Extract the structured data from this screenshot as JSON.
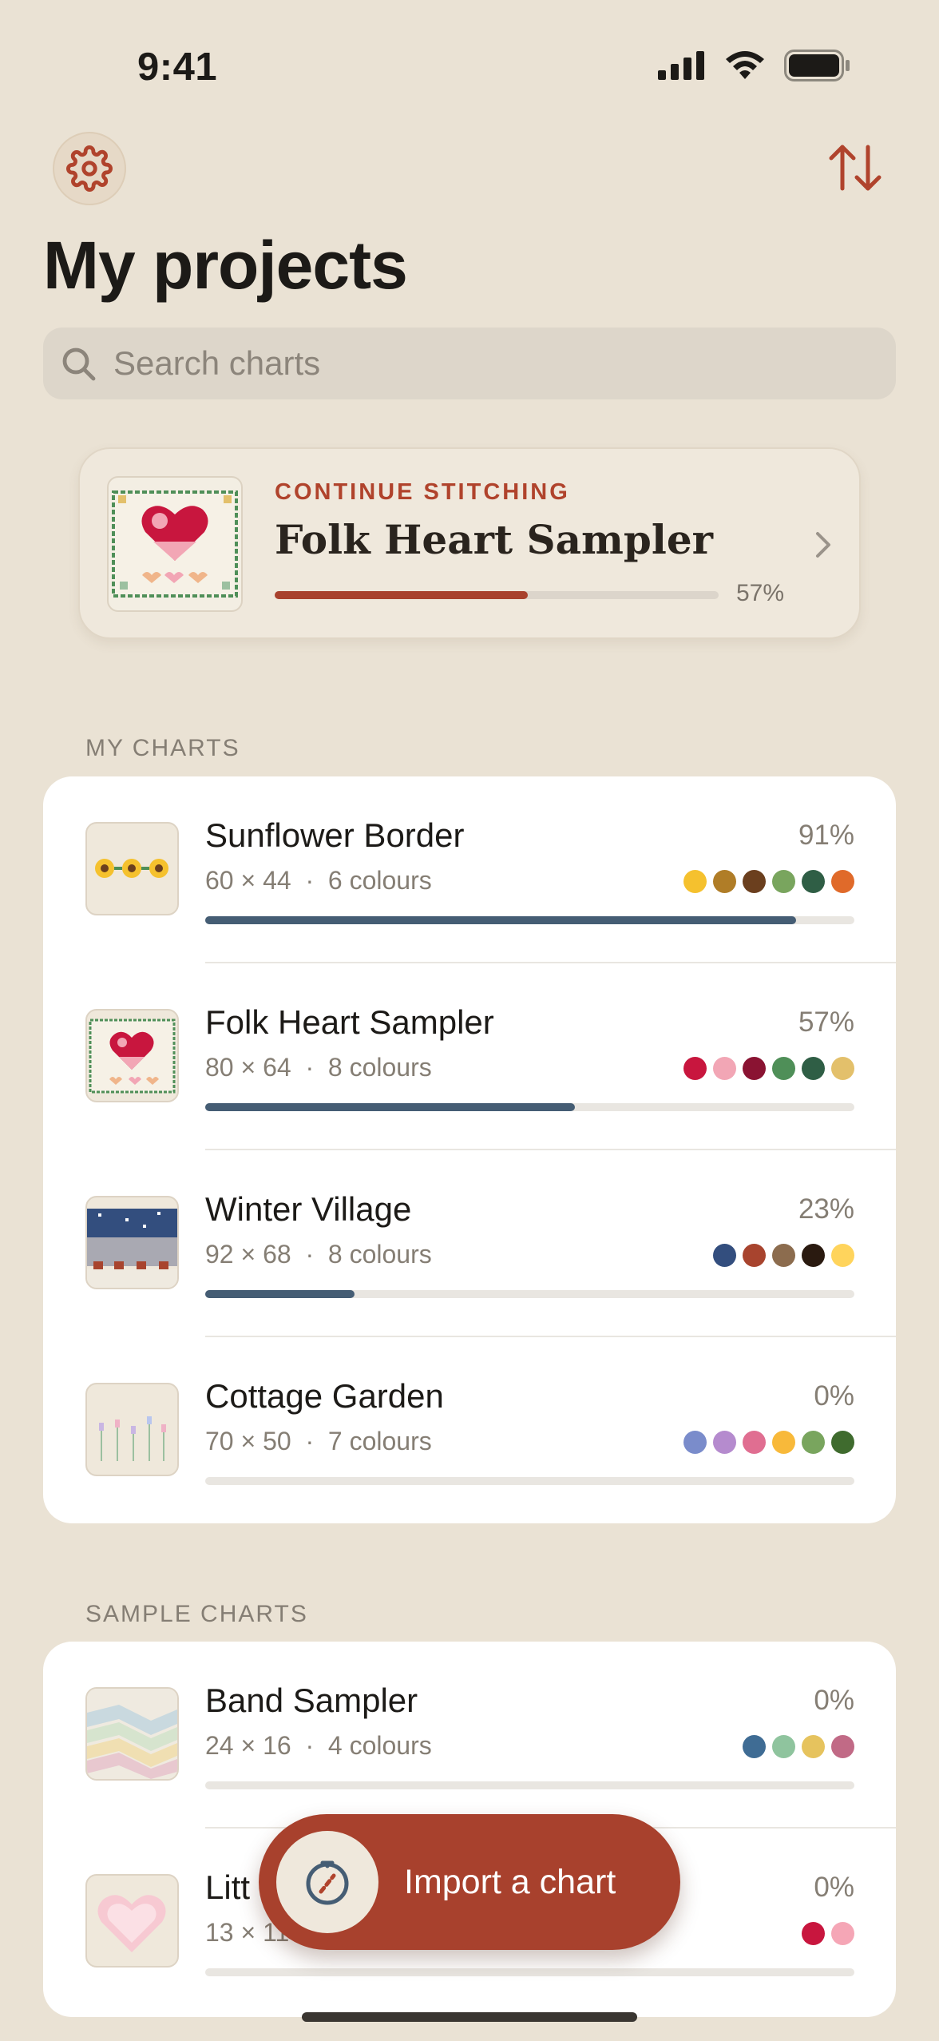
{
  "status_bar": {
    "time": "9:41"
  },
  "header": {
    "title": "My projects",
    "settings_icon": "gear-icon",
    "sort_icon": "sort-arrows-icon"
  },
  "search": {
    "placeholder": "Search charts",
    "value": ""
  },
  "continue": {
    "eyebrow": "CONTINUE STITCHING",
    "name": "Folk Heart Sampler",
    "progress_text": "57%",
    "progress": 0.57
  },
  "my_charts": {
    "label": "MY CHARTS",
    "items": [
      {
        "name": "Sunflower Border",
        "dims": "60 × 44",
        "colours": "6 colours",
        "pct": "91%",
        "progress": 0.91,
        "swatches": [
          "#F5C12E",
          "#B07D27",
          "#6B3F1E",
          "#79A55E",
          "#2F5E45",
          "#E06A2A"
        ]
      },
      {
        "name": "Folk Heart Sampler",
        "dims": "80 × 64",
        "colours": "8 colours",
        "pct": "57%",
        "progress": 0.57,
        "swatches": [
          "#C8163E",
          "#F2A6B5",
          "#8A1332",
          "#4F8F58",
          "#2F5E45",
          "#E3C06B"
        ]
      },
      {
        "name": "Winter Village",
        "dims": "92 × 68",
        "colours": "8 colours",
        "pct": "23%",
        "progress": 0.23,
        "swatches": [
          "#334E7E",
          "#A8442E",
          "#8C6C4E",
          "#2A1A10",
          "#FFD45C"
        ]
      },
      {
        "name": "Cottage Garden",
        "dims": "70 × 50",
        "colours": "7 colours",
        "pct": "0%",
        "progress": 0.0,
        "swatches": [
          "#7A8CCB",
          "#B58BCE",
          "#E06E91",
          "#F8B93A",
          "#79A55E",
          "#3F6B2E"
        ]
      }
    ]
  },
  "sample_charts": {
    "label": "SAMPLE CHARTS",
    "items": [
      {
        "name": "Band Sampler",
        "dims": "24 × 16",
        "colours": "4 colours",
        "pct": "0%",
        "progress": 0.0,
        "swatches": [
          "#3F6C94",
          "#8FC49E",
          "#E6C35E",
          "#C16A86"
        ]
      },
      {
        "name": "Litt",
        "dims": "13 × 11",
        "colours": "",
        "pct": "0%",
        "progress": 0.0,
        "swatches": [
          "#C8163E",
          "#F5A6B6"
        ]
      }
    ]
  },
  "import_button": {
    "label": "Import a chart",
    "icon": "import-link-icon"
  }
}
